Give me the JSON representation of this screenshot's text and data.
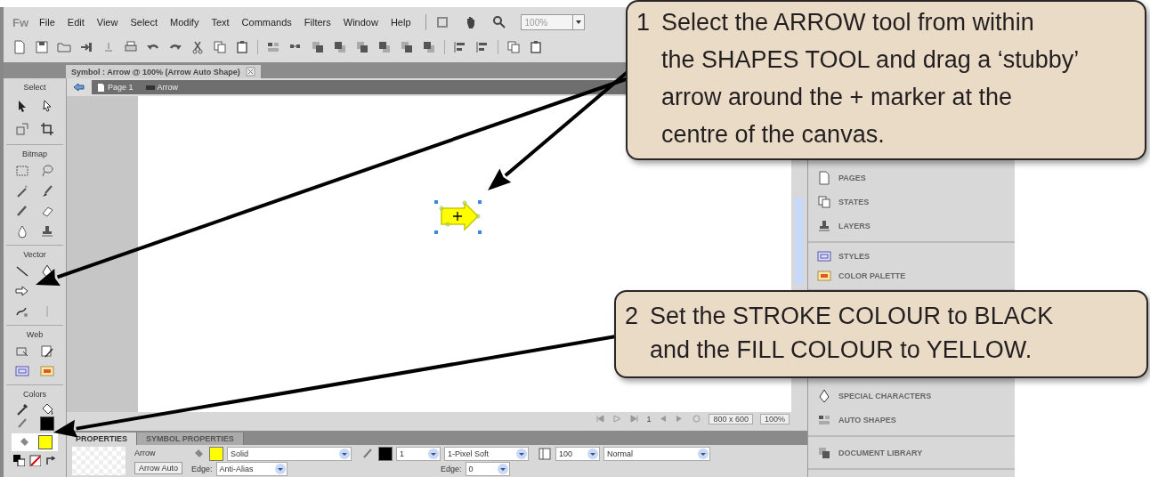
{
  "app": {
    "logo": "Fw",
    "menu": [
      "File",
      "Edit",
      "View",
      "Select",
      "Modify",
      "Text",
      "Commands",
      "Filters",
      "Window",
      "Help"
    ],
    "zoom_field": {
      "value": "100%"
    }
  },
  "document_tab": {
    "title": "Symbol : Arrow @ 100% (Arrow Auto Shape)"
  },
  "page_bar": {
    "page": "Page 1",
    "symbol": "Arrow"
  },
  "toolbox": {
    "sections": [
      {
        "label": "Select"
      },
      {
        "label": "Bitmap"
      },
      {
        "label": "Vector"
      },
      {
        "label": "Web"
      },
      {
        "label": "Colors"
      }
    ],
    "stroke": {
      "color": "#000000"
    },
    "fill": {
      "color": "#ffff00"
    }
  },
  "status_bar": {
    "page_number": "1",
    "canvas_size": "800 x 600",
    "zoom": "100%"
  },
  "properties": {
    "tabs": [
      {
        "label": "PROPERTIES",
        "selected": true
      },
      {
        "label": "SYMBOL PROPERTIES",
        "selected": false
      }
    ],
    "name": "Arrow",
    "type": "Arrow Auto",
    "fill": {
      "color": "#ffff00",
      "type": "Solid",
      "edge_label": "Edge:",
      "edge": "Anti-Alias"
    },
    "stroke": {
      "color": "#000000",
      "size": "1",
      "type": "1-Pixel Soft",
      "edge_label": "Edge:",
      "edge": "0"
    },
    "opacity": "100",
    "blend": "Normal"
  },
  "panels": [
    [
      "PAGES",
      "STATES",
      "LAYERS"
    ],
    [
      "STYLES",
      "COLOR PALETTE"
    ],
    [
      "SPECIAL CHARACTERS",
      "AUTO SHAPES"
    ],
    [
      "DOCUMENT LIBRARY"
    ]
  ],
  "callouts": [
    {
      "number": "1",
      "text": "Select the ARROW tool from within\nthe SHAPES TOOL and drag a ‘stubby’\narrow around the + marker at the\ncentre of the canvas."
    },
    {
      "number": "2",
      "text": "Set the STROKE COLOUR to BLACK\nand the FILL COLOUR to YELLOW."
    }
  ]
}
